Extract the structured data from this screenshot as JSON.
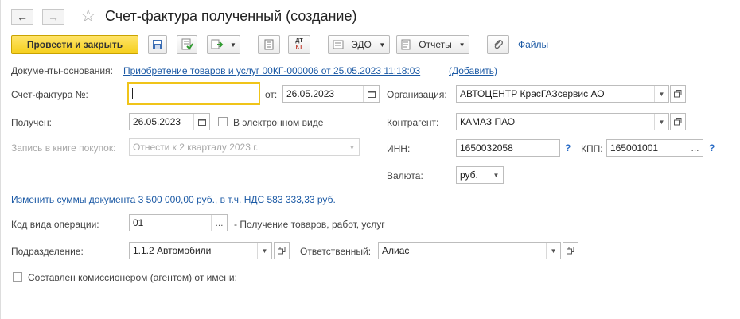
{
  "header": {
    "title": "Счет-фактура полученный (создание)",
    "back_glyph": "←",
    "forward_glyph": "→",
    "star_glyph": "☆"
  },
  "toolbar": {
    "post_close_label": "Провести и закрыть",
    "dt_kt_label_top": "ДТ",
    "dt_kt_label_bottom": "КТ",
    "edo_label": "ЭДО",
    "reports_label": "Отчеты",
    "files_label": "Файлы"
  },
  "basis": {
    "label": "Документы-основания:",
    "doc_link": "Приобретение товаров и услуг 00КГ-000006 от 25.05.2023 11:18:03",
    "add_link": "(Добавить)"
  },
  "form": {
    "invoice_no_label": "Счет-фактура №:",
    "invoice_no_value": "",
    "date_from_label": "от:",
    "date_from_value": "26.05.2023",
    "received_label": "Получен:",
    "received_value": "26.05.2023",
    "electronic_label": "В электронном виде",
    "book_label": "Запись в книге покупок:",
    "book_value": "Отнести к 2 кварталу 2023 г.",
    "org_label": "Организация:",
    "org_value": "АВТОЦЕНТР КрасГАЗсервис АО",
    "counterparty_label": "Контрагент:",
    "counterparty_value": "КАМАЗ ПАО",
    "inn_label": "ИНН:",
    "inn_value": "1650032058",
    "kpp_label": "КПП:",
    "kpp_value": "165001001",
    "currency_label": "Валюта:",
    "currency_value": "руб.",
    "change_sums_link": "Изменить суммы документа 3 500 000,00 руб., в т.ч. НДС 583 333,33 руб.",
    "op_code_label": "Код вида операции:",
    "op_code_value": "01",
    "op_code_desc": "- Получение товаров, работ, услуг",
    "division_label": "Подразделение:",
    "division_value": "1.1.2 Автомобили",
    "responsible_label": "Ответственный:",
    "responsible_value": "Алиас",
    "commissioner_label": "Составлен комиссионером (агентом) от имени:",
    "ellipsis": "...",
    "question": "?"
  }
}
